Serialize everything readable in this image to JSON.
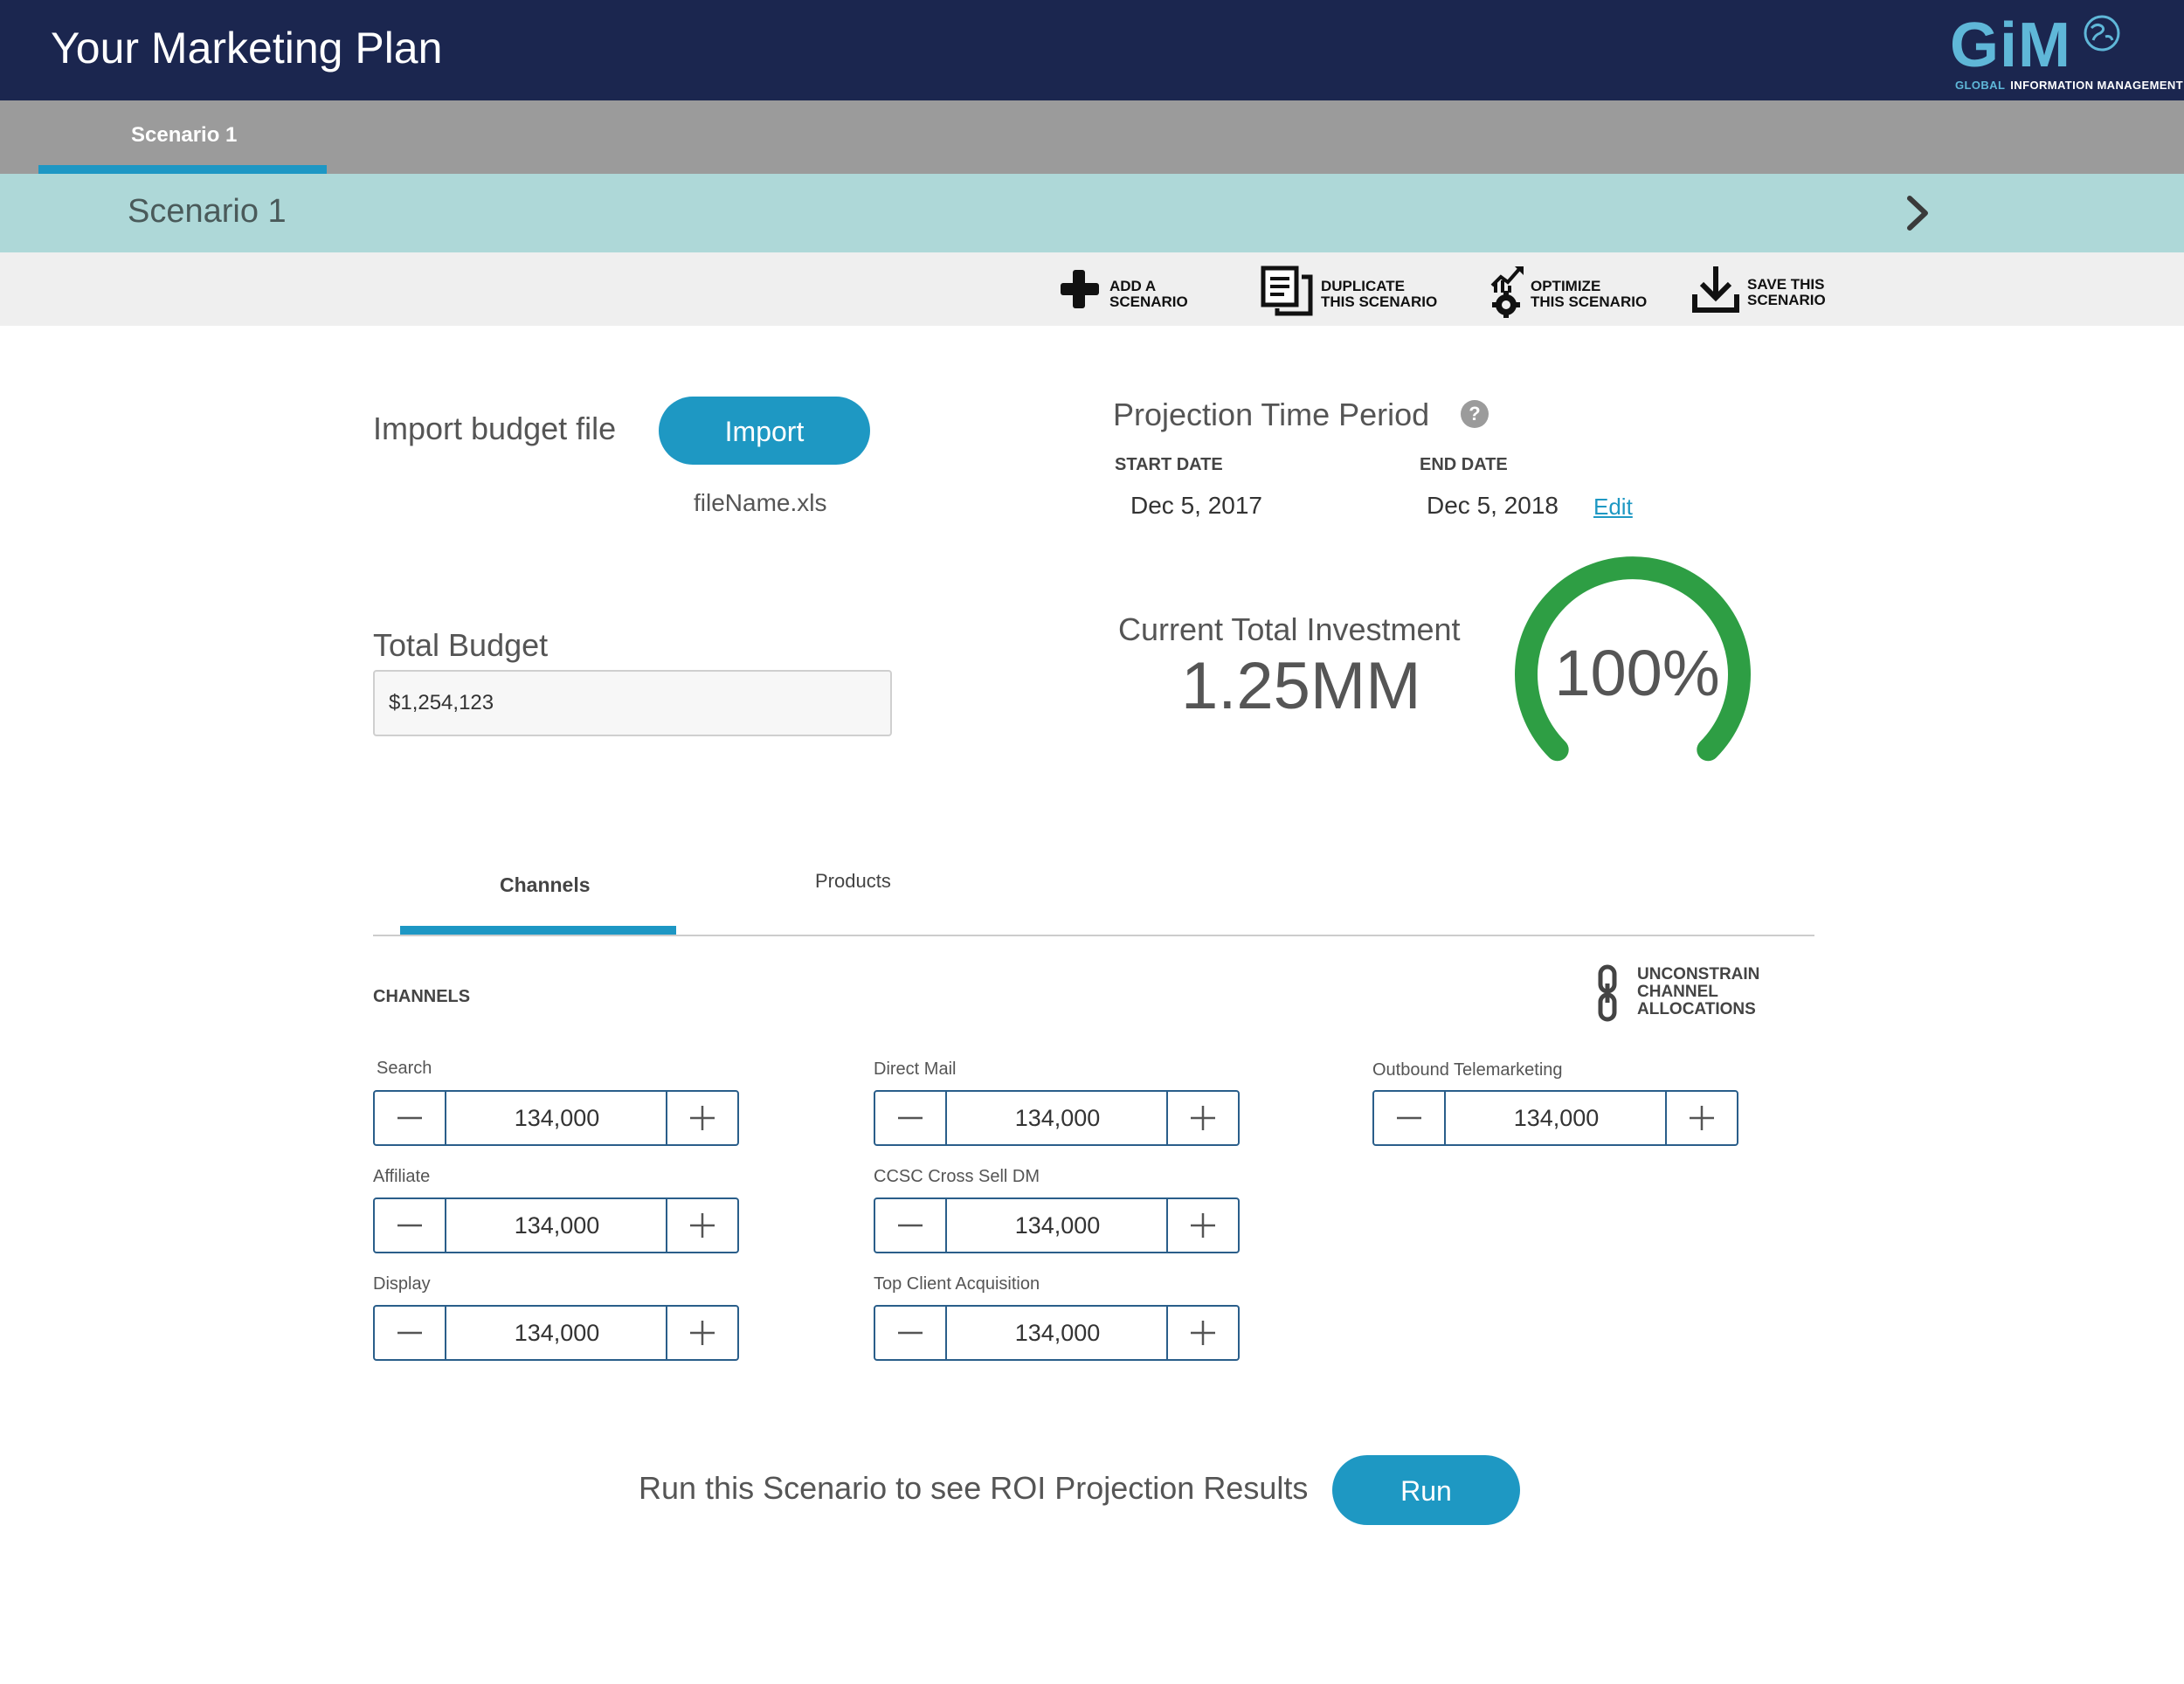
{
  "header": {
    "title": "Your Marketing Plan",
    "logo_mark": "GiM",
    "logo_sub_global": "GLOBAL",
    "logo_sub_rest": "INFORMATION MANAGEMENT"
  },
  "scenario_tabs": [
    {
      "label": "Scenario 1",
      "active": true
    }
  ],
  "scenario_strip": {
    "name": "Scenario 1"
  },
  "toolbar": {
    "add": [
      "ADD A",
      "SCENARIO"
    ],
    "duplicate": [
      "DUPLICATE",
      "THIS SCENARIO"
    ],
    "optimize": [
      "OPTIMIZE",
      "THIS SCENARIO"
    ],
    "save": [
      "SAVE THIS",
      "SCENARIO"
    ]
  },
  "import": {
    "label": "Import budget file",
    "button": "Import",
    "file_name": "fileName.xls"
  },
  "projection": {
    "title": "Projection Time Period",
    "help": "?",
    "start_label": "START DATE",
    "start_value": "Dec 5, 2017",
    "end_label": "END DATE",
    "end_value": "Dec 5, 2018",
    "edit": "Edit"
  },
  "budget": {
    "label": "Total Budget",
    "value": "$1,254,123"
  },
  "investment": {
    "label": "Current Total Investment",
    "value": "1.25MM",
    "percent_label": "100%",
    "percent": 100
  },
  "colors": {
    "header_bg": "#1b264f",
    "accent_blue": "#1e98c3",
    "strip_teal": "#aed8d8",
    "gauge_green": "#2e9e44",
    "stepper_border": "#2a5e8a"
  },
  "content_tabs": {
    "channels": "Channels",
    "products": "Products"
  },
  "channels": {
    "heading": "CHANNELS",
    "unconstrain": [
      "UNCONSTRAIN",
      "CHANNEL",
      "ALLOCATIONS"
    ],
    "items": [
      {
        "name": "Search",
        "value": "134,000"
      },
      {
        "name": "Affiliate",
        "value": "134,000"
      },
      {
        "name": "Display",
        "value": "134,000"
      },
      {
        "name": "Direct Mail",
        "value": "134,000"
      },
      {
        "name": "CCSC Cross Sell DM",
        "value": "134,000"
      },
      {
        "name": "Top Client Acquisition",
        "value": "134,000"
      },
      {
        "name": "Outbound Telemarketing",
        "value": "134,000"
      }
    ]
  },
  "run": {
    "text": "Run this Scenario to see ROI Projection Results",
    "button": "Run"
  }
}
